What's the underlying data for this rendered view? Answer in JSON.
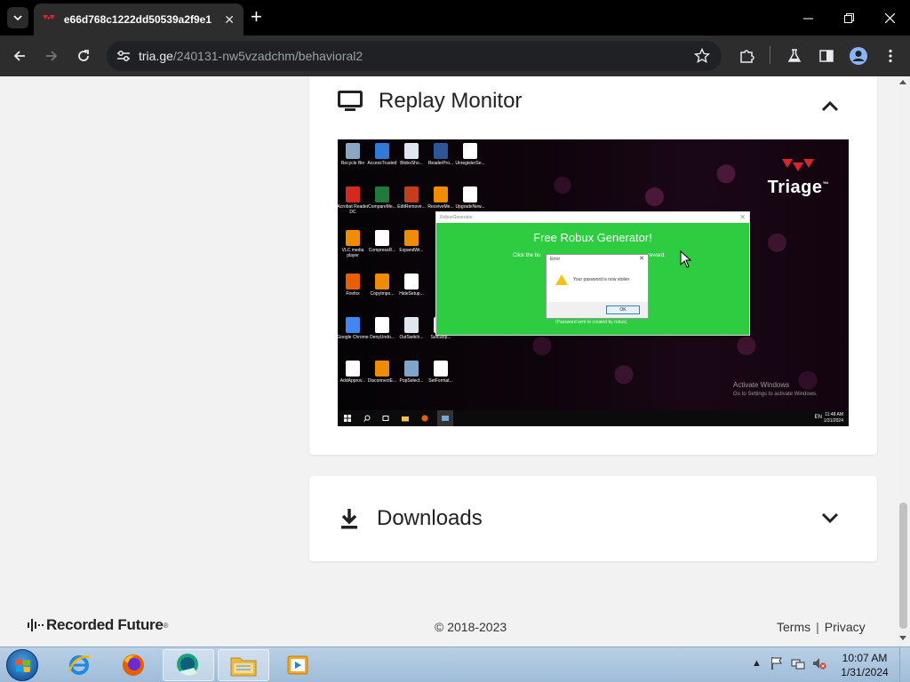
{
  "browser": {
    "tab_title": "e66d768c1222dd50539a2f9e1",
    "url_host": "tria.ge",
    "url_path": "/240131-nw5vzadchm/behavioral2"
  },
  "colors": {
    "triage_red": "#d9252a",
    "robux_green": "#2ecc40",
    "page_bg": "#f2f2f2"
  },
  "replay": {
    "title": "Replay Monitor",
    "icon": "monitor-icon",
    "collapse_icon": "chevron-up-icon",
    "vm": {
      "logo_text": "Triage",
      "logo_mark": "™",
      "desktop_icons": [
        {
          "label": "Recycle Bin",
          "color": "#8aa7c4"
        },
        {
          "label": "AccessTrusted",
          "color": "#2f7bd8"
        },
        {
          "label": "BlobsSho...",
          "color": "#dfe6ef"
        },
        {
          "label": "ReaderPro...",
          "color": "#2b5797"
        },
        {
          "label": "UnregisterSe...",
          "color": "#ffffff"
        },
        {
          "label": "Acrobat Reader DC",
          "color": "#d42a1e"
        },
        {
          "label": "CompareMe...",
          "color": "#1f7a3f"
        },
        {
          "label": "EditRemove...",
          "color": "#c43e1c"
        },
        {
          "label": "ReceiveMe...",
          "color": "#f08c00"
        },
        {
          "label": "UpgradeNew...",
          "color": "#ffffff"
        },
        {
          "label": "VLC media player",
          "color": "#f08c00"
        },
        {
          "label": "CompressR...",
          "color": "#ffffff"
        },
        {
          "label": "ExpandWr...",
          "color": "#f08c00"
        },
        {
          "label": "Firefox",
          "color": "#e66000"
        },
        {
          "label": "CopyImpo...",
          "color": "#f08c00"
        },
        {
          "label": "HideSetup...",
          "color": "#ffffff"
        },
        {
          "label": "Google Chrome",
          "color": "#4285f4"
        },
        {
          "label": "DenyUndo...",
          "color": "#ffffff"
        },
        {
          "label": "OutSwitch...",
          "color": "#dfe6ef"
        },
        {
          "label": "SuitStop...",
          "color": "#dfe6ef"
        },
        {
          "label": "AddApprov...",
          "color": "#ffffff"
        },
        {
          "label": "DisconnectE...",
          "color": "#f08c00"
        },
        {
          "label": "PopSelect...",
          "color": "#7fa6c9"
        },
        {
          "label": "SetFormat...",
          "color": "#ffffff"
        }
      ],
      "robux_window_title": "RobuxGenerator",
      "robux_heading": "Free Robux Generator!",
      "robux_instructions_left": "Click the bu",
      "robux_instructions_right": "reward.",
      "robux_footer": "(Password sent to created by robux)",
      "error_title": "Error",
      "error_message": "Your password is now stolen",
      "error_ok": "OK",
      "activate_line1": "Activate Windows",
      "activate_line2": "Go to Settings to activate Windows.",
      "vm_lang": "EN",
      "vm_time": "11:48 AM",
      "vm_date": "1/31/2024"
    }
  },
  "downloads": {
    "title": "Downloads",
    "icon": "download-icon",
    "expand_icon": "chevron-down-icon"
  },
  "footer": {
    "brand": "Recorded Future",
    "brand_mark": "®",
    "copyright": "© 2018-2023",
    "links": [
      "Terms",
      "Privacy"
    ],
    "separator": "|"
  },
  "taskbar": {
    "apps": [
      "internet-explorer-icon",
      "firefox-icon",
      "app-icon",
      "file-explorer-icon",
      "media-player-icon"
    ],
    "time": "10:07 AM",
    "date": "1/31/2024"
  }
}
